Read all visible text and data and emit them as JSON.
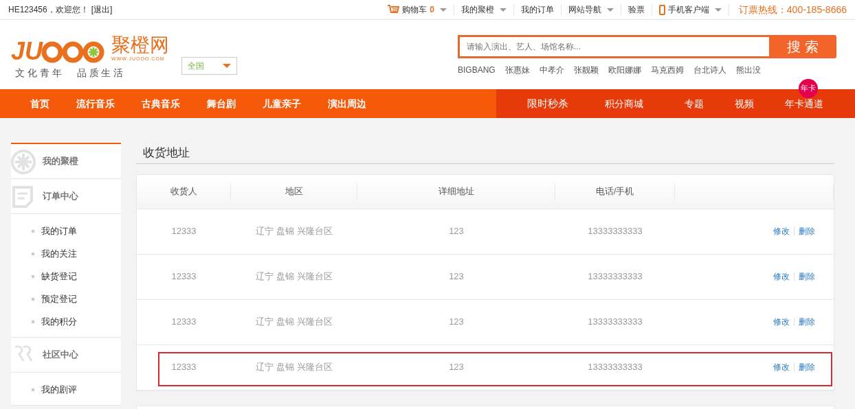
{
  "topbar": {
    "greeting": "HE123456，欢迎您！",
    "logout": "[退出]",
    "links": [
      {
        "kind": "cart",
        "label": "购物车",
        "count": "0",
        "dropdown": true
      },
      {
        "kind": "link",
        "label": "我的聚橙",
        "dropdown": true
      },
      {
        "kind": "link",
        "label": "我的订单",
        "dropdown": false
      },
      {
        "kind": "link",
        "label": "网站导航",
        "dropdown": true
      },
      {
        "kind": "link",
        "label": "验票",
        "dropdown": false
      },
      {
        "kind": "phone",
        "label": "手机客户端",
        "dropdown": true
      }
    ],
    "hotline": "订票热线：400-185-8666"
  },
  "header": {
    "logo": {
      "wordmark": "JU",
      "name": "聚橙网",
      "url": "WWW.JUOOO.COM",
      "slogan": [
        "文 化 青 年",
        "品 质 生 活"
      ]
    },
    "region": "全国",
    "search": {
      "placeholder": "请输入演出、艺人、场馆名称...",
      "button": "搜 索"
    },
    "hot_keywords": [
      "BIGBANG",
      "张惠妹",
      "中孝介",
      "张靓颖",
      "欧阳娜娜",
      "马克西姆",
      "台北诗人",
      "熊出没"
    ]
  },
  "nav": {
    "main": [
      "首页",
      "流行音乐",
      "古典音乐",
      "舞台剧",
      "儿童亲子",
      "演出周边"
    ],
    "promo": [
      {
        "label": "限时秒杀"
      },
      {
        "label": "积分商城"
      },
      {
        "label": "专题"
      },
      {
        "label": "视频"
      },
      {
        "label": "年卡通道",
        "badge": "年卡"
      }
    ]
  },
  "sidebar": {
    "sections": [
      {
        "title": "我的聚橙"
      },
      {
        "title": "订单中心",
        "children": [
          "我的订单",
          "我的关注",
          "缺货登记",
          "预定登记",
          "我的积分"
        ]
      },
      {
        "title": "社区中心",
        "children": [
          "我的剧评"
        ]
      }
    ]
  },
  "page_title": "收货地址",
  "table": {
    "columns": [
      "收货人",
      "地区",
      "详细地址",
      "电话/手机"
    ],
    "rows": [
      {
        "name": "12333",
        "region": "辽宁 盘锦 兴隆台区",
        "address": "123",
        "phone": "13333333333",
        "actions": [
          "修改",
          "删除"
        ],
        "highlighted": false
      },
      {
        "name": "12333",
        "region": "辽宁 盘锦 兴隆台区",
        "address": "123",
        "phone": "13333333333",
        "actions": [
          "修改",
          "删除"
        ],
        "highlighted": false
      },
      {
        "name": "12333",
        "region": "辽宁 盘锦 兴隆台区",
        "address": "123",
        "phone": "13333333333",
        "actions": [
          "修改",
          "删除"
        ],
        "highlighted": false
      },
      {
        "name": "12333",
        "region": "辽宁 盘锦 兴隆台区",
        "address": "123",
        "phone": "13333333333",
        "actions": [
          "修改",
          "删除"
        ],
        "highlighted": true
      }
    ]
  }
}
